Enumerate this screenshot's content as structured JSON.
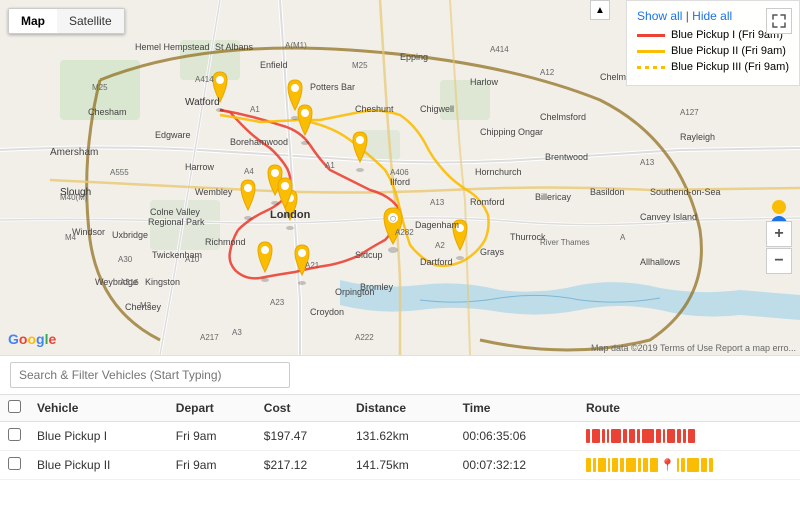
{
  "map": {
    "tabs": [
      {
        "label": "Map",
        "active": true
      },
      {
        "label": "Satellite",
        "active": false
      }
    ],
    "legend": {
      "show_all": "Show all",
      "hide_all": "Hide all",
      "separator": "|",
      "items": [
        {
          "label": "Blue Pickup I (Fri 9am)",
          "color": "#ea4335",
          "dash": false
        },
        {
          "label": "Blue Pickup II (Fri 9am)",
          "color": "#fbbc04",
          "dash": false
        },
        {
          "label": "Blue Pickup III (Fri 9am)",
          "color": "#fbbc04",
          "dash": true
        }
      ]
    },
    "controls": {
      "zoom_in": "+",
      "zoom_out": "−"
    },
    "attribution": "Map data ©2019 Terms of Use Report a map erro..."
  },
  "search": {
    "placeholder": "Search & Filter Vehicles (Start Typing)"
  },
  "table": {
    "headers": [
      {
        "key": "checkbox",
        "label": ""
      },
      {
        "key": "vehicle",
        "label": "Vehicle"
      },
      {
        "key": "depart",
        "label": "Depart"
      },
      {
        "key": "cost",
        "label": "Cost"
      },
      {
        "key": "distance",
        "label": "Distance"
      },
      {
        "key": "time",
        "label": "Time"
      },
      {
        "key": "route",
        "label": "Route"
      }
    ],
    "rows": [
      {
        "id": "row1",
        "vehicle": "Blue Pickup I",
        "depart": "Fri 9am",
        "cost": "$197.47",
        "distance": "131.62km",
        "time": "00:06:35:06",
        "route_color": "#ea4335",
        "route_bars": [
          4,
          8,
          3,
          2,
          10,
          4,
          6,
          3,
          12,
          5,
          2,
          8,
          4,
          3,
          7
        ],
        "striped": false
      },
      {
        "id": "row2",
        "vehicle": "Blue Pickup II",
        "depart": "Fri 9am",
        "cost": "$217.12",
        "distance": "141.75km",
        "time": "00:07:32:12",
        "route_color": "#fbbc04",
        "route_bars": [
          5,
          3,
          8,
          2,
          6,
          4,
          10,
          3,
          5,
          8,
          2,
          4,
          3,
          6,
          4
        ],
        "striped": false
      }
    ]
  },
  "header_checkbox": {
    "label": ""
  }
}
